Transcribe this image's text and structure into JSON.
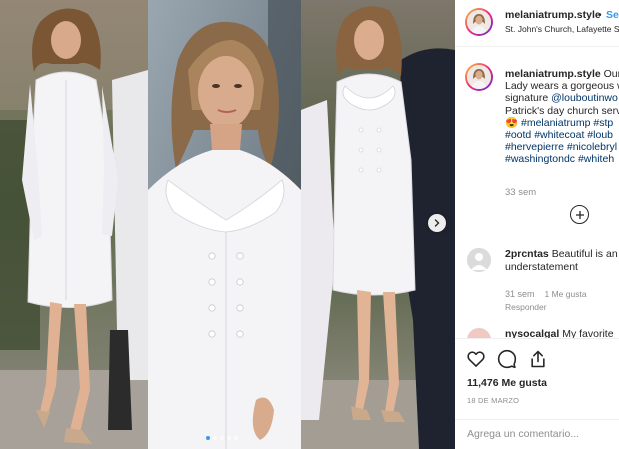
{
  "post": {
    "username": "melaniatrump.style",
    "separator": "•",
    "follow_label": "Se",
    "location": "St. John's Church, Lafayette S"
  },
  "caption": {
    "username": "melaniatrump.style",
    "lines": [
      " Our",
      "Lady wears a gorgeous w",
      "signature @louboutinwo",
      "Patrick's day church serv",
      "😍 #melaniatrump #stp",
      "#ootd #whitecoat #loub",
      "#hervepierre #nicolebryl",
      "#washingtondc #whiteh"
    ],
    "line2_mention": "@louboutinwo",
    "time": "33 sem"
  },
  "comments": [
    {
      "username": "2prcntas",
      "text_1": " Beautiful is an",
      "text_2": "understatement",
      "time": "31 sem",
      "likes": "1 Me gusta",
      "reply": "Responder"
    },
    {
      "username": "nysocalgal",
      "text_1": " My favorite"
    }
  ],
  "actions": {
    "likes": "11,476 Me gusta",
    "date": "18 DE MARZO"
  },
  "comment_box": {
    "placeholder": "Agrega un comentario..."
  },
  "carousel": {
    "slide_count": 5,
    "active_index": 0
  },
  "colors": {
    "link_blue": "#3897f0",
    "hashtag_blue": "#003569",
    "meta_gray": "#8e8e8e",
    "coat_white": "#f4f3f6"
  },
  "icons": [
    "heart-icon",
    "comment-icon",
    "share-icon",
    "plus-circle-icon",
    "chevron-right-icon"
  ]
}
